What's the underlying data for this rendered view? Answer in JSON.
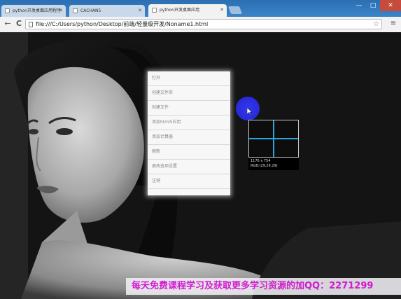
{
  "tabs": [
    {
      "label": "python开发桌面应用程序",
      "active": false
    },
    {
      "label": "CACHAN5",
      "active": false
    },
    {
      "label": "python开发桌面应用",
      "active": true
    }
  ],
  "window_controls": {
    "minimize": "—",
    "maximize": "□",
    "close": "✕"
  },
  "toolbar": {
    "back": "←",
    "reload": "C",
    "url": "file:///C:/Users/python/Desktop/前端/轻量级开发/Noname1.html",
    "bookmark": "☆",
    "menu": "≡"
  },
  "context_menu": {
    "items": [
      "打开",
      "创建文件夹",
      "创建文件",
      "添加html5应用",
      "添加计算器",
      "刷新",
      "更改选项设置",
      "注销"
    ]
  },
  "magnifier": {
    "size_text": "1176 x 754",
    "rgb_text": "RGB:(29,29,29)",
    "crosshair_color": "#2aa7d8"
  },
  "promo": {
    "text": "每天免费课程学习及获取更多学习资源的加QQ：2271299"
  },
  "colors": {
    "accent_blue": "#2f39f0",
    "promo_pink": "#d21ad0",
    "tabstrip_blue": "#3b84c8"
  }
}
